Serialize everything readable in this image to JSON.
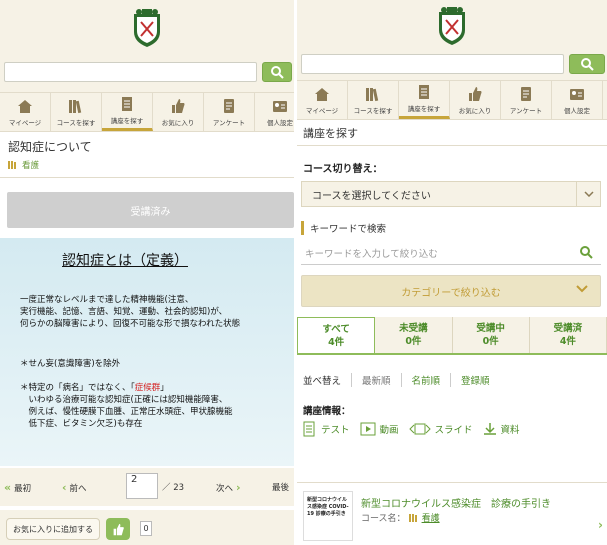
{
  "colors": {
    "accent_green": "#8ebc5a",
    "gold": "#c7a53a",
    "header_bg": "#f6f2e6"
  },
  "nav": [
    {
      "label": "マイページ",
      "icon": "home-icon"
    },
    {
      "label": "コースを探す",
      "icon": "books-icon"
    },
    {
      "label": "講座を探す",
      "icon": "document-icon"
    },
    {
      "label": "お気に入り",
      "icon": "thumbs-up-icon"
    },
    {
      "label": "アンケート",
      "icon": "survey-icon"
    },
    {
      "label": "個人設定",
      "icon": "profile-icon"
    }
  ],
  "left": {
    "course_title": "認知症について",
    "category": "看護",
    "done_button": "受講済み",
    "slide": {
      "title": "認知症とは（定義）",
      "p1_l1": "一度正常なレベルまで達した精神機能(注意、",
      "p1_l2": "実行機能、記憶、言語、知覚、運動、社会的認知)が、",
      "p1_l3": "何らかの脳障害により、回復不可能な形で損なわれた状態",
      "b1": "＊せん妄(意識障害)を除外",
      "b2_pre": "＊特定の「病名」ではなく、「",
      "b2_red": "症候群",
      "b2_post": "」",
      "b2_l2": "　いわゆる治療可能な認知症(正確には認知機能障害、",
      "b2_l3": "　例えば、慢性硬膜下血腫、正常圧水頭症、甲状腺機能",
      "b2_l4": "　低下症、ビタミン欠乏)も存在"
    },
    "pager": {
      "first": "最初",
      "prev": "前へ",
      "current": "2",
      "total": "／ 23",
      "next": "次へ",
      "last": "最後"
    },
    "fav_button": "お気に入りに追加する",
    "like_count": "0"
  },
  "right": {
    "page_title": "講座を探す",
    "course_switch_label": "コース切り替え：",
    "course_select_value": "コースを選択してください",
    "keyword_label": "キーワードで検索",
    "keyword_placeholder": "キーワードを入力して絞り込む",
    "category_filter": "カテゴリーで絞り込む",
    "tabs": [
      {
        "label": "すべて",
        "count": "4件"
      },
      {
        "label": "未受講",
        "count": "0件"
      },
      {
        "label": "受講中",
        "count": "0件"
      },
      {
        "label": "受講済",
        "count": "4件"
      }
    ],
    "sort_label": "並べ替え",
    "sort_options": [
      "最新順",
      "名前順",
      "登録順"
    ],
    "info_label": "講座情報：",
    "info_items": [
      "テスト",
      "動画",
      "スライド",
      "資料"
    ],
    "card": {
      "title": "新型コロナウイルス感染症　診療の手引き",
      "course_key": "コース名：",
      "course_value": "看護",
      "thumb_text": "新型コロナウイルス感染症 COVID-19 診療の手引き"
    }
  }
}
